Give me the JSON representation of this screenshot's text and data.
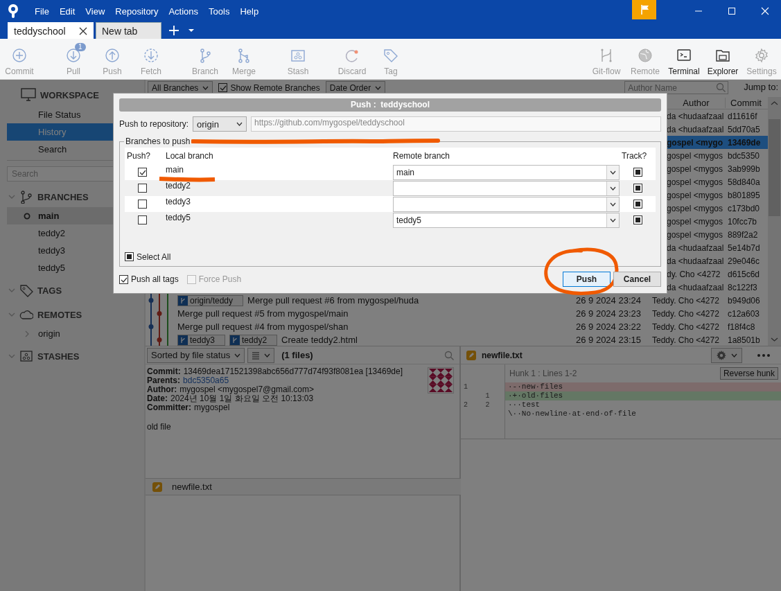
{
  "window": {
    "menu": [
      "File",
      "Edit",
      "View",
      "Repository",
      "Actions",
      "Tools",
      "Help"
    ]
  },
  "tabs": [
    {
      "label": "teddyschool",
      "selected": true,
      "closable": true
    },
    {
      "label": "New tab",
      "selected": false,
      "closable": false
    }
  ],
  "toolbar": {
    "left_groups": [
      [
        {
          "label": "Commit",
          "disabled": true
        }
      ],
      [
        {
          "label": "Pull",
          "disabled": true,
          "badge": "1"
        },
        {
          "label": "Push",
          "disabled": true
        },
        {
          "label": "Fetch",
          "disabled": true
        }
      ],
      [
        {
          "label": "Branch",
          "disabled": true
        },
        {
          "label": "Merge",
          "disabled": true
        }
      ],
      [
        {
          "label": "Stash",
          "disabled": true
        }
      ],
      [
        {
          "label": "Discard",
          "disabled": true
        },
        {
          "label": "Tag",
          "disabled": true
        }
      ]
    ],
    "right": [
      {
        "label": "Git-flow",
        "disabled": true
      },
      {
        "label": "Remote",
        "disabled": true
      },
      {
        "label": "Terminal",
        "disabled": false
      },
      {
        "label": "Explorer",
        "disabled": false
      },
      {
        "label": "Settings",
        "disabled": true
      }
    ]
  },
  "sidebar": {
    "workspace": {
      "title": "WORKSPACE",
      "items": [
        {
          "label": "File Status",
          "selected": false
        },
        {
          "label": "History",
          "selected": true
        },
        {
          "label": "Search",
          "selected": false
        }
      ]
    },
    "search": {
      "placeholder": "Search"
    },
    "sections": [
      {
        "kind": "branches",
        "title": "BRANCHES",
        "expanded": true,
        "items": [
          {
            "label": "main",
            "current": true,
            "selected": true
          },
          {
            "label": "teddy2",
            "current": false,
            "selected": false
          },
          {
            "label": "teddy3",
            "current": false,
            "selected": false
          },
          {
            "label": "teddy5",
            "current": false,
            "selected": false
          }
        ]
      },
      {
        "kind": "tags",
        "title": "TAGS",
        "expanded": true
      },
      {
        "kind": "remotes",
        "title": "REMOTES",
        "expanded": true,
        "items": [
          {
            "label": "origin",
            "expanded": false
          }
        ]
      },
      {
        "kind": "stashes",
        "title": "STASHES",
        "expanded": true
      }
    ]
  },
  "history": {
    "toolbar": {
      "branch_filter": "All Branches",
      "show_remote": {
        "label": "Show Remote Branches",
        "checked": true
      },
      "order": "Date Order",
      "author_search": {
        "placeholder": "Author Name"
      },
      "jump_label": "Jump to:"
    },
    "columns": [
      "Author",
      "Commit"
    ],
    "rows": [
      {
        "author": "da <hudaafzaal",
        "commit": "d11616f",
        "selected": false
      },
      {
        "author": "da <hudaafzaal",
        "commit": "5dd70a5",
        "selected": false
      },
      {
        "author": "gospel <mygo",
        "commit": "13469de",
        "selected": true
      },
      {
        "author": "gospel <mygos",
        "commit": "bdc5350",
        "selected": false
      },
      {
        "author": "gospel <mygos",
        "commit": "3ab999b",
        "selected": false
      },
      {
        "author": "gospel <mygos",
        "commit": "58d840a",
        "selected": false
      },
      {
        "author": "gospel <mygos",
        "commit": "b801895",
        "selected": false
      },
      {
        "author": "gospel <mygos",
        "commit": "c173bd0",
        "selected": false
      },
      {
        "author": "gospel <mygos",
        "commit": "10fcc7b",
        "selected": false
      },
      {
        "author": "gospel <mygos",
        "commit": "889f2a2",
        "selected": false
      },
      {
        "author": "da <hudaafzaal",
        "commit": "5e14b7d",
        "selected": false
      },
      {
        "author": "da <hudaafzaal",
        "commit": "29e046c",
        "selected": false
      },
      {
        "author": "dy. Cho <4272",
        "commit": "d615c6d",
        "selected": false
      },
      {
        "author": "da <hudaafzaal",
        "commit": "8c122f3",
        "selected": false
      },
      {
        "labels": [
          "origin/teddy"
        ],
        "description": "Merge pull request #6 from mygospel/huda",
        "date": "26 9 2024 23:24",
        "author": "Teddy. Cho <4272",
        "commit": "b949d06",
        "selected": false
      },
      {
        "description": "Merge pull request #5 from mygospel/main",
        "date": "26 9 2024 23:23",
        "author": "Teddy. Cho <4272",
        "commit": "c12a603",
        "selected": false
      },
      {
        "description": "Merge pull request #4 from mygospel/shan",
        "date": "26 9 2024 23:22",
        "author": "Teddy. Cho <4272",
        "commit": "f18f4c8",
        "selected": false
      },
      {
        "labels": [
          "teddy3",
          "teddy2"
        ],
        "description": "Create teddy2.html",
        "date": "26 9 2024 23:15",
        "author": "Teddy. Cho <4272",
        "commit": "1a8501b",
        "selected": false
      }
    ]
  },
  "details": {
    "sort": "Sorted by file status",
    "file_count": "(1 files)",
    "commit_info": [
      {
        "label": "Commit:",
        "value": "13469dea171521398abc656d777d74f93f8081ea [13469de]",
        "kind": "text"
      },
      {
        "label": "Parents:",
        "value": "bdc5350a65",
        "kind": "link"
      },
      {
        "label": "Author:",
        "value": "mygospel <mygospel7@gmail.com>",
        "kind": "text"
      },
      {
        "label": "Date:",
        "value": "2024년 10월 1일 화요일 오전 10:13:03",
        "kind": "text"
      },
      {
        "label": "Committer:",
        "value": "mygospel",
        "kind": "text"
      }
    ],
    "message": "old file",
    "files": [
      {
        "name": "newfile.txt"
      }
    ]
  },
  "diff": {
    "file": "newfile.txt",
    "hunk": "Hunk 1 : Lines 1-2",
    "reverse_button": "Reverse hunk",
    "lines": [
      {
        "old": "1",
        "text": "·-·new·files",
        "kind": "removed"
      },
      {
        "new": "1",
        "text": "·+·old·files",
        "kind": "added"
      },
      {
        "old": "2",
        "new": "2",
        "text": "···test",
        "kind": "context"
      },
      {
        "text": "\\··No·newline·at·end·of·file",
        "kind": "context"
      }
    ]
  },
  "dialog": {
    "title": "Push :  teddyschool",
    "repo_label": "Push to repository:",
    "remote": "origin",
    "url": "https://github.com/mygospel/teddyschool",
    "group_label": "Branches to push",
    "group_underlined": true,
    "columns": [
      "Push?",
      "Local branch",
      "Remote branch",
      "Track?"
    ],
    "rows": [
      {
        "push": true,
        "local": "main",
        "remote": "main",
        "track": true,
        "underlined": true
      },
      {
        "push": false,
        "local": "teddy2",
        "track": true,
        "underlined": false
      },
      {
        "push": false,
        "local": "teddy3",
        "track": true,
        "underlined": false
      },
      {
        "push": false,
        "local": "teddy5",
        "remote": "teddy5",
        "track": true,
        "underlined": false
      }
    ],
    "select_all": {
      "label": "Select All",
      "checked": true
    },
    "push_all_tags": {
      "label": "Push all tags",
      "checked": true,
      "disabled": false
    },
    "force_push": {
      "label": "Force Push",
      "checked": false,
      "disabled": true
    },
    "buttons": [
      {
        "label": "Push",
        "kind": "default",
        "circled": true
      },
      {
        "label": "Cancel",
        "kind": "normal",
        "circled": false
      }
    ]
  }
}
